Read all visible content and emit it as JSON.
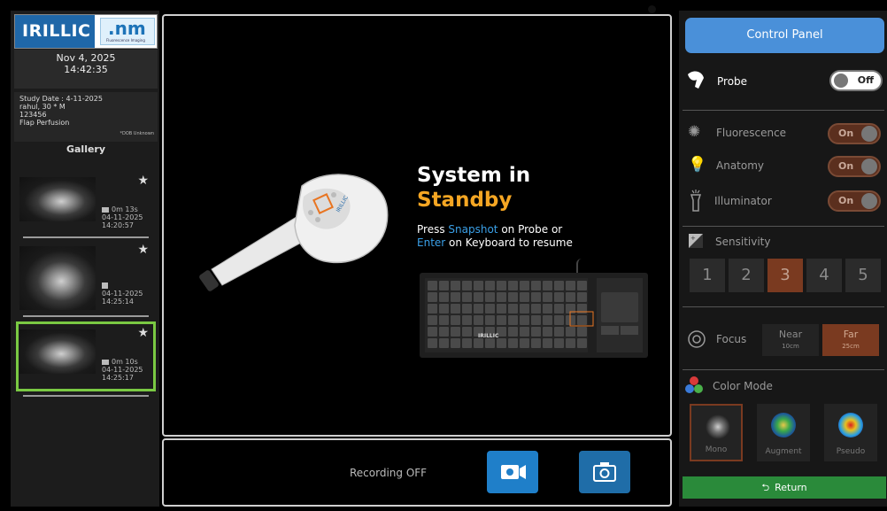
{
  "brand": {
    "logo_left": "IRILLIC",
    "logo_right": ".nm",
    "logo_right_sub": "Fluorescence Imaging"
  },
  "datetime": {
    "date": "Nov 4, 2025",
    "time": "14:42:35"
  },
  "study": {
    "date_line": "Study Date : 4-11-2025",
    "patient_line": "rahul, 30 * M",
    "id_line": "123456",
    "procedure_line": "Flap Perfusion",
    "dob_note": "*DOB Unknown"
  },
  "gallery": {
    "title": "Gallery",
    "items": [
      {
        "kind": "video",
        "duration": "0m 13s",
        "date": "04-11-2025",
        "time": "14:20:57",
        "selected": false
      },
      {
        "kind": "image",
        "duration": "",
        "date": "04-11-2025",
        "time": "14:25:14",
        "selected": false
      },
      {
        "kind": "video",
        "duration": "0m 10s",
        "date": "04-11-2025",
        "time": "14:25:17",
        "selected": true
      }
    ]
  },
  "viewer": {
    "headline_1": "System in",
    "headline_2": "Standby",
    "instr_press": "Press ",
    "instr_snapshot": "Snapshot",
    "instr_on_probe": " on Probe or",
    "instr_enter": "Enter",
    "instr_keyboard": " on Keyboard to resume",
    "keyboard_brand": "IRILLIC"
  },
  "recording": {
    "status": "Recording OFF"
  },
  "control_panel": {
    "title": "Control Panel",
    "probe": {
      "label": "Probe",
      "state": "Off"
    },
    "fluorescence": {
      "label": "Fluorescence",
      "state": "On"
    },
    "anatomy": {
      "label": "Anatomy",
      "state": "On"
    },
    "illuminator": {
      "label": "Illuminator",
      "state": "On"
    },
    "sensitivity": {
      "label": "Sensitivity",
      "levels": [
        "1",
        "2",
        "3",
        "4",
        "5"
      ],
      "selected": "3"
    },
    "focus": {
      "label": "Focus",
      "near": "Near",
      "near_dist": "10cm",
      "far": "Far",
      "far_dist": "25cm",
      "selected": "Far"
    },
    "color_mode": {
      "label": "Color Mode",
      "modes": [
        "Mono",
        "Augment",
        "Pseudo"
      ],
      "selected": "Mono"
    },
    "return_label": "Return"
  },
  "colors": {
    "accent_blue": "#4a90d9",
    "active_orange": "#7a3a20",
    "selection_green": "#7ac943",
    "return_green": "#2a8a3a",
    "standby_orange": "#f5a623"
  }
}
